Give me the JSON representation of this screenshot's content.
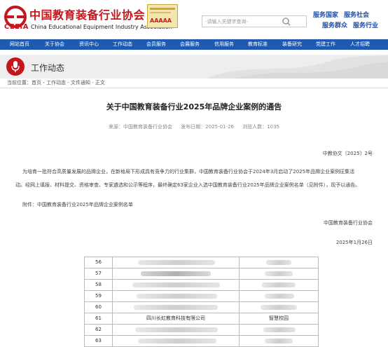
{
  "header": {
    "logo_cn": "中国教育装备行业协会",
    "logo_en_abbr": "CEEIA",
    "logo_en": "China Educational Equipment Industry Association",
    "badge_text": "AAAAA",
    "search_placeholder": "-请输入关键字查询-",
    "slogans": [
      "服务国家",
      "服务社会",
      "服务群众",
      "服务行业"
    ]
  },
  "nav": [
    "网站首页",
    "关于协会",
    "资讯中心",
    "工作动态",
    "会员服务",
    "会展服务",
    "信用服务",
    "教育标准",
    "装备研究",
    "党建工作",
    "人才招聘"
  ],
  "banner": {
    "title": "工作动态"
  },
  "breadcrumb": "当前位置：首页 - 工作动态 - 文件通知 - 正文",
  "article": {
    "title": "关于中国教育装备行业2025年品牌企业案例的通告",
    "source": "来源：中国教育装备行业协会",
    "date": "发布日期：2025-01-26",
    "views": "浏览人数：1035",
    "doc_no": "中教协文〔2025〕2号",
    "para1_line1": "为培育一批符合高质量发展的品牌企业，在新格局下形成具有竞争力的行业集群，中国教育装备行业协会于2024年3月启动了2025年品牌企业案例征集活",
    "para1_line2": "动。经网上填报、材料提交、资格审查、专家遴选和公示等程序，最终确定63家企业入选中国教育装备行业2025年品牌企业案例名单（见附件），现予以通告。",
    "attachment": "附件：中国教育装备行业2025年品牌企业案例名单",
    "signature": "中国教育装备行业协会",
    "sign_date": "2025年1月26日"
  },
  "table": {
    "rows": [
      {
        "no": "56",
        "company": "",
        "case": ""
      },
      {
        "no": "57",
        "company": "",
        "case": ""
      },
      {
        "no": "58",
        "company": "",
        "case": ""
      },
      {
        "no": "59",
        "company": "",
        "case": ""
      },
      {
        "no": "60",
        "company": "",
        "case": ""
      },
      {
        "no": "61",
        "company": "四川长虹教育科技有限公司",
        "case": "智慧校园"
      },
      {
        "no": "62",
        "company": "",
        "case": ""
      },
      {
        "no": "63",
        "company": "",
        "case": ""
      }
    ]
  },
  "colors": {
    "brand_red": "#c4161c",
    "nav_blue": "#1e5bb0",
    "slogan_blue": "#1e4fa3"
  },
  "icons": [
    "ceeia-logo-icon",
    "microphone-icon",
    "search-icon"
  ]
}
